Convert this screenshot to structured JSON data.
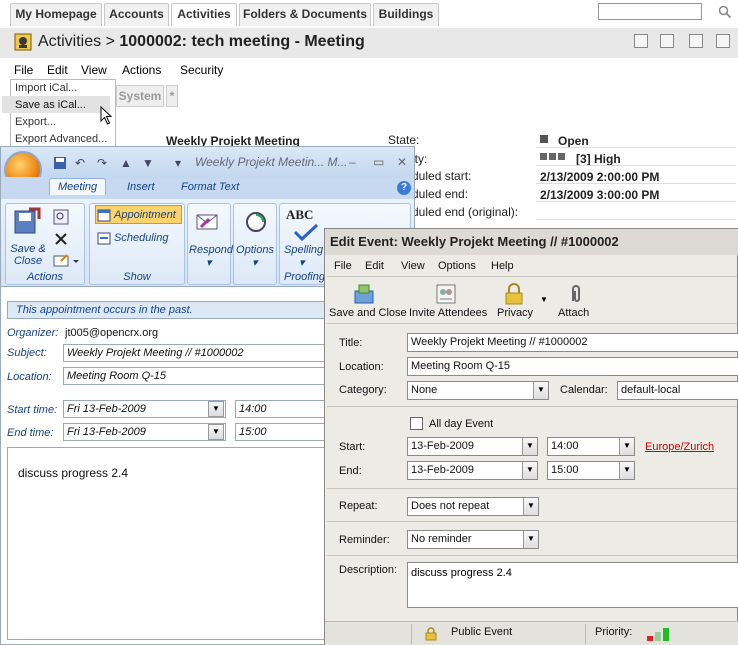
{
  "web": {
    "tabs": [
      "My Homepage",
      "Accounts",
      "Activities",
      "Folders & Documents",
      "Buildings"
    ],
    "active_tab": "Activities",
    "breadcrumb_prefix": "Activities >",
    "page_title": "1000002: tech meeting - Meeting",
    "menu": [
      "File",
      "Edit",
      "View",
      "Actions",
      "Security"
    ],
    "file_menu": [
      "Import iCal...",
      "Save as iCal...",
      "Export...",
      "Export Advanced..."
    ],
    "subtabs": [
      "System",
      "*"
    ],
    "activity_name": "Weekly Projekt Meeting",
    "fields": [
      {
        "label": "State:",
        "value": "Open"
      },
      {
        "label": "ity:",
        "value": "[3] High"
      },
      {
        "label": "duled start:",
        "value": "2/13/2009 2:00:00 PM"
      },
      {
        "label": "duled end:",
        "value": "2/13/2009 3:00:00 PM"
      },
      {
        "label": "duled end (original):",
        "value": ""
      }
    ]
  },
  "outlook": {
    "caption": "Weekly Projekt Meetin... M...",
    "ribbon_tabs": [
      "Meeting",
      "Insert",
      "Format Text"
    ],
    "groups": {
      "actions": "Actions",
      "show": "Show",
      "proofing": "Proofing"
    },
    "buttons": {
      "save_close": "Save &\nClose",
      "appointment": "Appointment",
      "scheduling": "Scheduling",
      "respond": "Respond",
      "options": "Options",
      "spelling": "Spelling",
      "abc": "ABC"
    },
    "info_bar": "This appointment occurs in the past.",
    "organizer_label": "Organizer:",
    "organizer": "jt005@opencrx.org",
    "subject_label": "Subject:",
    "subject": "Weekly Projekt Meeting // #1000002",
    "location_label": "Location:",
    "location": "Meeting Room Q-15",
    "start_label": "Start time:",
    "start_date": "Fri 13-Feb-2009",
    "start_time": "14:00",
    "end_label": "End time:",
    "end_date": "Fri 13-Feb-2009",
    "end_time": "15:00",
    "body": "discuss progress 2.4"
  },
  "edit": {
    "title": "Edit Event: Weekly Projekt Meeting // #1000002",
    "menu": [
      "File",
      "Edit",
      "View",
      "Options",
      "Help"
    ],
    "toolbar": [
      "Save and Close",
      "Invite Attendees",
      "Privacy",
      "Attach"
    ],
    "title_label": "Title:",
    "title_value": "Weekly Projekt Meeting // #1000002",
    "location_label": "Location:",
    "location_value": "Meeting Room Q-15",
    "category_label": "Category:",
    "category_value": "None",
    "calendar_label": "Calendar:",
    "calendar_value": "default-local",
    "all_day_label": "All day Event",
    "start_label": "Start:",
    "start_date": "13-Feb-2009",
    "start_time": "14:00",
    "timezone": "Europe/Zurich",
    "end_label": "End:",
    "end_date": "13-Feb-2009",
    "end_time": "15:00",
    "repeat_label": "Repeat:",
    "repeat_value": "Does not repeat",
    "reminder_label": "Reminder:",
    "reminder_value": "No reminder",
    "description_label": "Description:",
    "description_value": "discuss progress 2.4",
    "status_privacy": "Public Event",
    "status_priority": "Priority:"
  }
}
